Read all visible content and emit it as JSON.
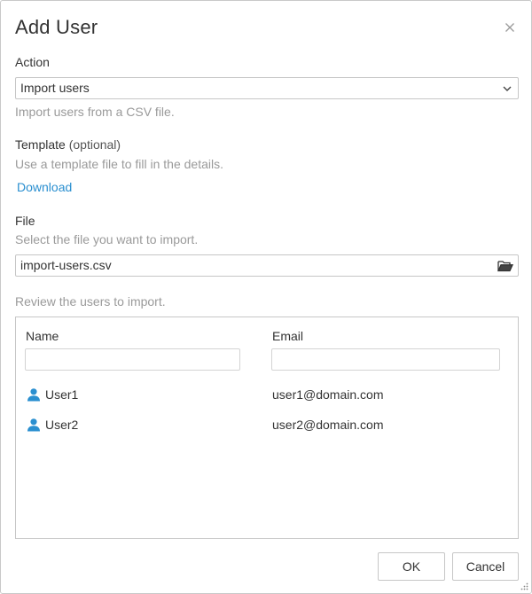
{
  "dialog": {
    "title": "Add User",
    "close_icon": "close-icon"
  },
  "action": {
    "label": "Action",
    "value": "Import users",
    "hint": "Import users from a CSV file.",
    "icon": "chevron-down-icon"
  },
  "template": {
    "label": "Template",
    "optional": "(optional)",
    "hint": "Use a template file to fill in the details.",
    "link": "Download"
  },
  "file": {
    "label": "File",
    "hint": "Select the file you want to import.",
    "value": "import-users.csv",
    "icon": "folder-open-icon"
  },
  "review": {
    "hint": "Review the users to import.",
    "columns": [
      "Name",
      "Email"
    ],
    "rows": [
      {
        "name": "User1",
        "email": "user1@domain.com",
        "icon": "user-icon"
      },
      {
        "name": "User2",
        "email": "user2@domain.com",
        "icon": "user-icon"
      }
    ]
  },
  "buttons": {
    "ok": "OK",
    "cancel": "Cancel"
  },
  "colors": {
    "accent": "#2a8fd0",
    "hint_text": "#9a9a9a",
    "border": "#c6c6c6"
  }
}
